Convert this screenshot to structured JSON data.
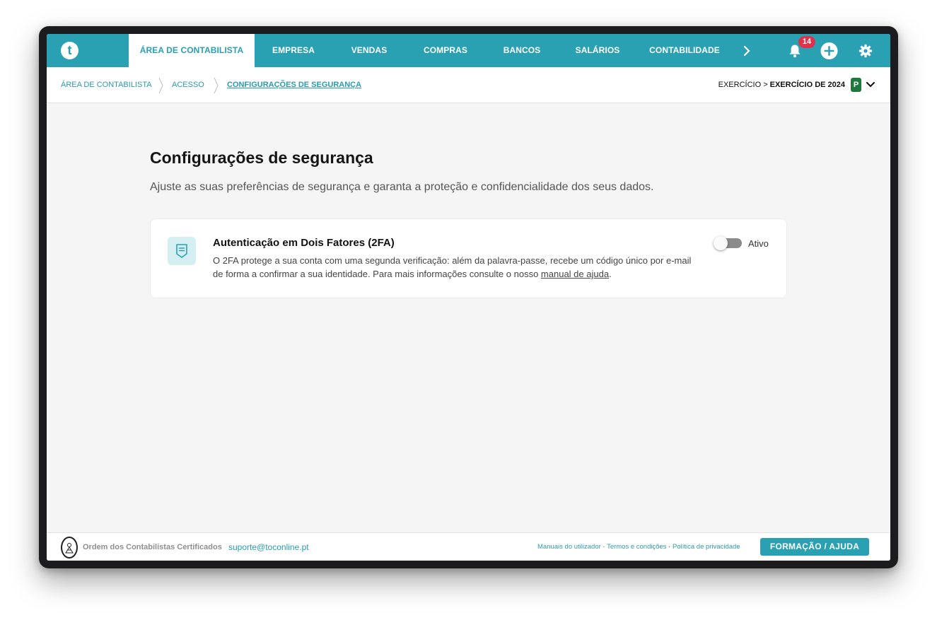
{
  "nav": {
    "logo_letter": "t",
    "tabs": [
      {
        "label": "ÁREA DE CONTABILISTA",
        "active": true
      },
      {
        "label": "EMPRESA"
      },
      {
        "label": "VENDAS"
      },
      {
        "label": "COMPRAS"
      },
      {
        "label": "BANCOS"
      },
      {
        "label": "SALÁRIOS"
      },
      {
        "label": "CONTABILIDADE"
      }
    ],
    "next_icon": "chevron-right-icon",
    "notifications_count": "14",
    "icons": [
      "bell-icon",
      "plus-circle-icon",
      "gear-icon"
    ]
  },
  "breadcrumb": {
    "items": [
      "ÁREA DE CONTABILISTA",
      "ACESSO",
      "CONFIGURAÇÕES DE SEGURANÇA"
    ]
  },
  "exercise": {
    "prefix": "EXERCÍCIO >",
    "name": "EXERCÍCIO DE 2024",
    "badge": "P"
  },
  "page": {
    "title": "Configurações de segurança",
    "subtitle": "Ajuste as suas preferências de segurança e garanta a proteção e confidencialidade dos seus dados."
  },
  "card": {
    "icon": "shield-document-icon",
    "title": "Autenticação em Dois Fatores (2FA)",
    "description": "O 2FA protege a sua conta com uma segunda verificação: além da palavra-passe, recebe um código único por e-mail de forma a confirmar a sua identidade. Para mais informações consulte o nosso",
    "link_text": "manual de ajuda",
    "suffix": ".",
    "toggle_label": "Ativo",
    "toggle_on": false
  },
  "footer": {
    "org": "Ordem dos Contabilistas Certificados",
    "email": "suporte@toconline.pt",
    "links": [
      "Manuais do utilizador",
      "Termos e condições",
      "Política de privacidade"
    ],
    "separator": " · ",
    "help_button": "FORMAÇÃO / AJUDA"
  },
  "colors": {
    "brand": "#2aa0b3",
    "badge_red": "#e0334b",
    "exercise_green": "#1e7a3c"
  }
}
